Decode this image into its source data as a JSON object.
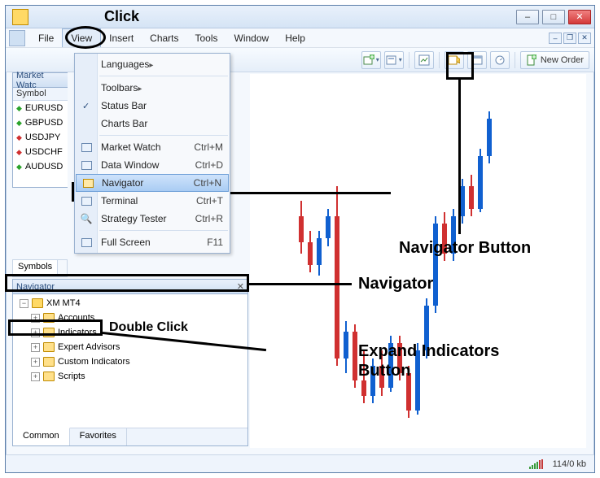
{
  "window": {
    "min": "–",
    "max": "□",
    "close": "✕"
  },
  "menubar": {
    "file": "File",
    "view": "View",
    "insert": "Insert",
    "charts": "Charts",
    "tools": "Tools",
    "window": "Window",
    "help": "Help"
  },
  "toolbar": {
    "new_order": "New Order"
  },
  "view_menu": {
    "languages": "Languages",
    "toolbars": "Toolbars",
    "status_bar": "Status Bar",
    "charts_bar": "Charts Bar",
    "market_watch": "Market Watch",
    "market_watch_sc": "Ctrl+M",
    "data_window": "Data Window",
    "data_window_sc": "Ctrl+D",
    "navigator": "Navigator",
    "navigator_sc": "Ctrl+N",
    "terminal": "Terminal",
    "terminal_sc": "Ctrl+T",
    "strategy_tester": "Strategy Tester",
    "strategy_tester_sc": "Ctrl+R",
    "full_screen": "Full Screen",
    "full_screen_sc": "F11"
  },
  "market_watch": {
    "title": "Market Watc",
    "col": "Symbol",
    "rows": [
      "EURUSD",
      "GBPUSD",
      "USDJPY",
      "USDCHF",
      "AUDUSD"
    ],
    "dirs": [
      "up",
      "up",
      "dn",
      "dn",
      "up"
    ]
  },
  "symbols_tab": "Symbols",
  "navigator": {
    "title": "Navigator",
    "root": "XM MT4",
    "items": [
      "Accounts",
      "Indicators",
      "Expert Advisors",
      "Custom Indicators",
      "Scripts"
    ],
    "tab_common": "Common",
    "tab_favorites": "Favorites"
  },
  "status": {
    "conn": "114/0 kb"
  },
  "annotations": {
    "click1": "Click",
    "click2": "Click",
    "nav_button": "Navigator Button",
    "nav_label": "Navigator",
    "double_click": "Double Click",
    "expand_ind": "Expand Indicators\nButton"
  },
  "chart_data": {
    "type": "candlestick",
    "title": "",
    "xlabel": "",
    "ylabel": "",
    "note": "price values are approximate relative heights read from pixels; no axis labels visible",
    "ylim": [
      0,
      100
    ],
    "candles": [
      {
        "o": 62,
        "h": 66,
        "l": 52,
        "c": 55,
        "dir": "down"
      },
      {
        "o": 55,
        "h": 58,
        "l": 47,
        "c": 49,
        "dir": "down"
      },
      {
        "o": 49,
        "h": 58,
        "l": 46,
        "c": 56,
        "dir": "up"
      },
      {
        "o": 56,
        "h": 64,
        "l": 54,
        "c": 62,
        "dir": "up"
      },
      {
        "o": 62,
        "h": 70,
        "l": 22,
        "c": 24,
        "dir": "down"
      },
      {
        "o": 24,
        "h": 34,
        "l": 20,
        "c": 31,
        "dir": "up"
      },
      {
        "o": 31,
        "h": 33,
        "l": 16,
        "c": 18,
        "dir": "down"
      },
      {
        "o": 18,
        "h": 26,
        "l": 12,
        "c": 14,
        "dir": "down"
      },
      {
        "o": 14,
        "h": 24,
        "l": 12,
        "c": 22,
        "dir": "up"
      },
      {
        "o": 22,
        "h": 26,
        "l": 14,
        "c": 16,
        "dir": "down"
      },
      {
        "o": 16,
        "h": 30,
        "l": 15,
        "c": 28,
        "dir": "up"
      },
      {
        "o": 28,
        "h": 30,
        "l": 18,
        "c": 20,
        "dir": "down"
      },
      {
        "o": 20,
        "h": 22,
        "l": 8,
        "c": 10,
        "dir": "down"
      },
      {
        "o": 10,
        "h": 28,
        "l": 9,
        "c": 26,
        "dir": "up"
      },
      {
        "o": 26,
        "h": 40,
        "l": 24,
        "c": 38,
        "dir": "up"
      },
      {
        "o": 38,
        "h": 62,
        "l": 36,
        "c": 60,
        "dir": "up"
      },
      {
        "o": 60,
        "h": 63,
        "l": 50,
        "c": 52,
        "dir": "down"
      },
      {
        "o": 52,
        "h": 64,
        "l": 50,
        "c": 62,
        "dir": "up"
      },
      {
        "o": 62,
        "h": 72,
        "l": 60,
        "c": 70,
        "dir": "up"
      },
      {
        "o": 70,
        "h": 73,
        "l": 62,
        "c": 64,
        "dir": "down"
      },
      {
        "o": 64,
        "h": 80,
        "l": 63,
        "c": 78,
        "dir": "up"
      },
      {
        "o": 78,
        "h": 90,
        "l": 76,
        "c": 88,
        "dir": "up"
      }
    ]
  }
}
